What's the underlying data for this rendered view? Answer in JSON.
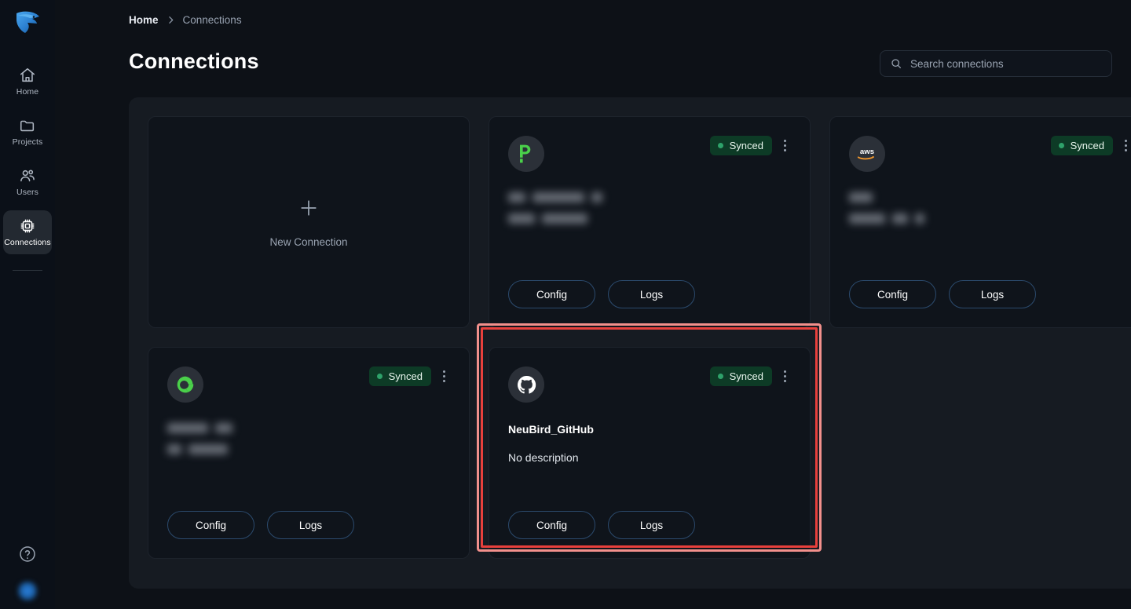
{
  "app": {
    "brand_logo_icon": "neubird-eagle-logo",
    "accent_blue": "#2b82e0",
    "panel_bg": "#161b22",
    "card_bg": "#0f141b",
    "status_green": "#2ea26a",
    "highlight_red": "#e8403c"
  },
  "sidebar": {
    "items": [
      {
        "label": "Home",
        "icon": "home-icon",
        "active": false
      },
      {
        "label": "Projects",
        "icon": "folder-icon",
        "active": false
      },
      {
        "label": "Users",
        "icon": "users-icon",
        "active": false
      },
      {
        "label": "Connections",
        "icon": "chip-icon",
        "active": true
      }
    ],
    "help_icon": "help-circle-icon",
    "avatar_icon": "user-avatar"
  },
  "header": {
    "breadcrumb": {
      "home": "Home",
      "separator": "chevron-right-icon",
      "current": "Connections"
    },
    "title": "Connections",
    "search": {
      "placeholder": "Search connections",
      "value": "",
      "icon": "search-icon"
    }
  },
  "cards": [
    {
      "type": "new",
      "icon": "plus-icon",
      "label": "New Connection"
    },
    {
      "type": "connection",
      "logo_icon": "pagerduty-logo",
      "status": "Synced",
      "menu_icon": "kebab-menu-icon",
      "name_redacted": true,
      "desc_redacted": true,
      "buttons": {
        "config": "Config",
        "logs": "Logs"
      }
    },
    {
      "type": "connection",
      "logo_icon": "aws-logo",
      "status": "Synced",
      "menu_icon": "kebab-menu-icon",
      "name_redacted": true,
      "desc_redacted": true,
      "buttons": {
        "config": "Config",
        "logs": "Logs"
      }
    },
    {
      "type": "connection",
      "logo_icon": "opsgenie-logo",
      "status": "Synced",
      "menu_icon": "kebab-menu-icon",
      "name_redacted": true,
      "desc_redacted": true,
      "buttons": {
        "config": "Config",
        "logs": "Logs"
      }
    },
    {
      "type": "connection",
      "logo_icon": "github-logo",
      "status": "Synced",
      "menu_icon": "kebab-menu-icon",
      "name": "NeuBird_GitHub",
      "description": "No description",
      "highlighted": true,
      "buttons": {
        "config": "Config",
        "logs": "Logs"
      }
    }
  ]
}
